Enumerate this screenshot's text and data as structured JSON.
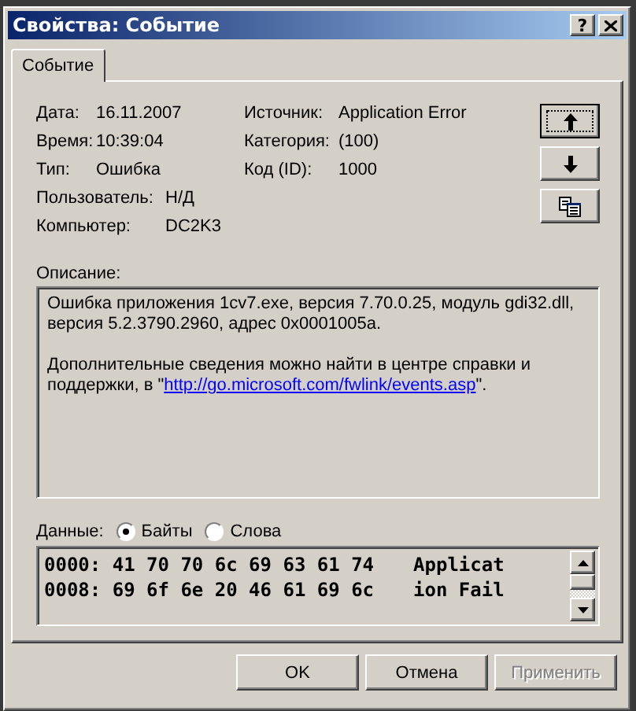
{
  "window": {
    "title": "Свойства: Событие",
    "help_button": "?"
  },
  "tabs": [
    {
      "label": "Событие",
      "selected": true
    }
  ],
  "left_fields": [
    {
      "label": "Дата:",
      "value": "16.11.2007"
    },
    {
      "label": "Время:",
      "value": "10:39:04"
    },
    {
      "label": "Тип:",
      "value": "Ошибка"
    }
  ],
  "user_fields": [
    {
      "label": "Пользователь:",
      "value": "Н/Д"
    },
    {
      "label": "Компьютер:",
      "value": "DC2K3"
    }
  ],
  "right_fields": [
    {
      "label": "Источник:",
      "value": "Application Error"
    },
    {
      "label": "Категория:",
      "value": "(100)"
    },
    {
      "label": "Код (ID):",
      "value": "1000"
    }
  ],
  "nav_buttons": [
    {
      "kind": "up",
      "focused": true
    },
    {
      "kind": "down",
      "focused": false
    },
    {
      "kind": "copy",
      "focused": false
    }
  ],
  "description": {
    "label": "Описание:",
    "paragraphs": [
      [
        {
          "text": "Ошибка приложения 1cv7.exe, версия 7.70.0.25, модуль gdi32.dll, версия 5.2.3790.2960, адрес 0x0001005a."
        }
      ],
      [
        {
          "text": "Дополнительные сведения можно найти в центре справки и поддержки, в \""
        },
        {
          "link": "http://go.microsoft.com/fwlink/events.asp"
        },
        {
          "text": "\"."
        }
      ]
    ]
  },
  "data": {
    "label": "Данные:",
    "options": [
      {
        "label": "Байты",
        "selected": true
      },
      {
        "label": "Слова",
        "selected": false
      }
    ],
    "rows": [
      {
        "hex": "0000: 41 70 70 6c 69 63 61 74",
        "ascii": "Applicat"
      },
      {
        "hex": "0008: 69 6f 6e 20 46 61 69 6c",
        "ascii": "ion Fail"
      }
    ]
  },
  "buttons": [
    {
      "label": "OK",
      "disabled": false
    },
    {
      "label": "Отмена",
      "disabled": false
    },
    {
      "label": "Применить",
      "disabled": true
    }
  ]
}
